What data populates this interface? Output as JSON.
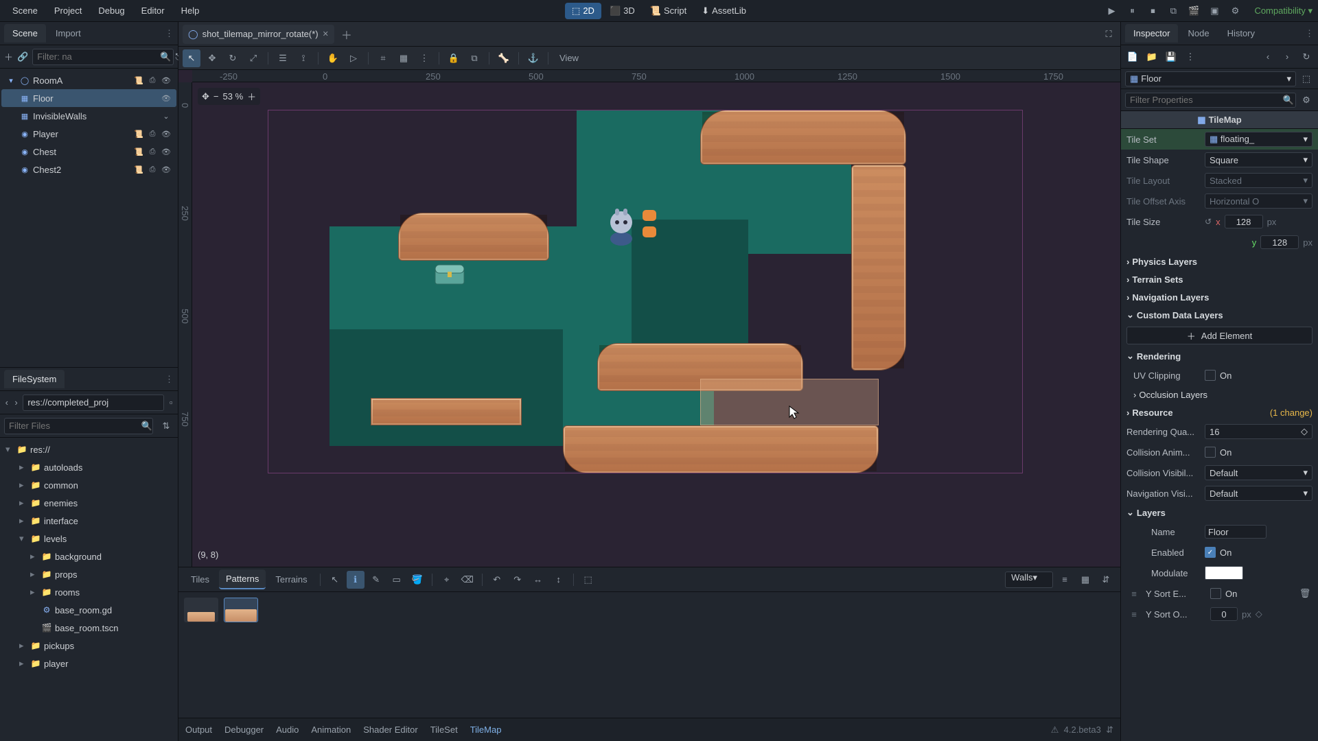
{
  "menubar": {
    "scene": "Scene",
    "project": "Project",
    "debug": "Debug",
    "editor": "Editor",
    "help": "Help",
    "mode_2d": "2D",
    "mode_3d": "3D",
    "script": "Script",
    "assetlib": "AssetLib",
    "renderer": "Compatibility"
  },
  "scene_dock": {
    "tab_scene": "Scene",
    "tab_import": "Import",
    "filter_placeholder": "Filter: na",
    "root": "RoomA",
    "items": [
      {
        "name": "Floor",
        "selected": true
      },
      {
        "name": "InvisibleWalls"
      },
      {
        "name": "Player"
      },
      {
        "name": "Chest"
      },
      {
        "name": "Chest2"
      }
    ]
  },
  "filesystem": {
    "title": "FileSystem",
    "path": "res://completed_proj",
    "filter_placeholder": "Filter Files",
    "root": "res://",
    "folders": [
      "autoloads",
      "common",
      "enemies",
      "interface",
      "levels"
    ],
    "levels_sub": [
      "background",
      "props",
      "rooms"
    ],
    "files": [
      "base_room.gd",
      "base_room.tscn"
    ],
    "tail_folders": [
      "pickups",
      "player"
    ]
  },
  "editor": {
    "tab_title": "shot_tilemap_mirror_rotate(*)",
    "zoom": "53 %",
    "coords": "(9, 8)",
    "view_btn": "View",
    "ruler_h": [
      "-250",
      "0",
      "250",
      "500",
      "750",
      "1000",
      "1250",
      "1500",
      "1750"
    ],
    "ruler_v": [
      "0",
      "250",
      "500",
      "750"
    ]
  },
  "tilemap_panel": {
    "tabs": {
      "tiles": "Tiles",
      "patterns": "Patterns",
      "terrains": "Terrains"
    },
    "layer": "Walls"
  },
  "bottom": {
    "tabs": [
      "Output",
      "Debugger",
      "Audio",
      "Animation",
      "Shader Editor",
      "TileSet",
      "TileMap"
    ],
    "active": "TileMap",
    "version": "4.2.beta3"
  },
  "inspector": {
    "tab_inspector": "Inspector",
    "tab_node": "Node",
    "tab_history": "History",
    "breadcrumb": "Floor",
    "filter_placeholder": "Filter Properties",
    "class": "TileMap",
    "tileset_label": "Tile Set",
    "tileset_value": "floating_",
    "tileshape_label": "Tile Shape",
    "tileshape_value": "Square",
    "tilelayout_label": "Tile Layout",
    "tilelayout_value": "Stacked",
    "tileoffset_label": "Tile Offset Axis",
    "tileoffset_value": "Horizontal O",
    "tilesize_label": "Tile Size",
    "tilesize_x": "128",
    "tilesize_y": "128",
    "px": "px",
    "x": "x",
    "y": "y",
    "physics_layers": "Physics Layers",
    "terrain_sets": "Terrain Sets",
    "navigation_layers": "Navigation Layers",
    "custom_data": "Custom Data Layers",
    "add_element": "Add Element",
    "rendering": "Rendering",
    "uv_clipping": "UV Clipping",
    "occlusion": "Occlusion Layers",
    "resource": "Resource",
    "resource_changes": "(1 change)",
    "rendering_quad": "Rendering Qua...",
    "rendering_quad_val": "16",
    "collision_anim": "Collision Anim...",
    "collision_vis": "Collision Visibil...",
    "collision_vis_val": "Default",
    "navigation_vis": "Navigation Visi...",
    "navigation_vis_val": "Default",
    "layers": "Layers",
    "layer_name": "Name",
    "layer_name_val": "Floor",
    "layer_enabled": "Enabled",
    "layer_modulate": "Modulate",
    "layer_ysort_e": "Y Sort E...",
    "layer_ysort_o": "Y Sort O...",
    "layer_ysort_o_val": "0",
    "on": "On"
  }
}
